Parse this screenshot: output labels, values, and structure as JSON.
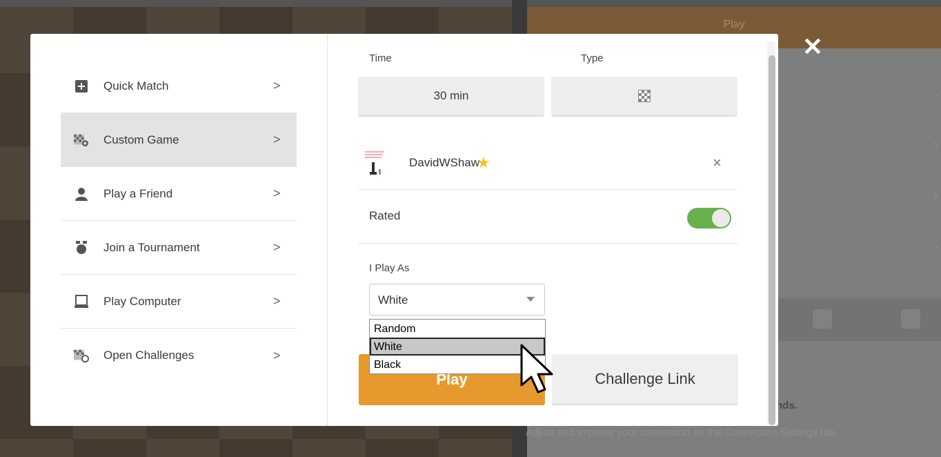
{
  "background": {
    "panel_header": "Play",
    "info_bold": "nds.",
    "info_text": "Adjust and improve your connection on the Connection Settings tab."
  },
  "menu": {
    "items": [
      {
        "label": "Quick Match",
        "icon": "plus-square-icon"
      },
      {
        "label": "Custom Game",
        "icon": "board-gear-icon"
      },
      {
        "label": "Play a Friend",
        "icon": "person-icon"
      },
      {
        "label": "Join a Tournament",
        "icon": "trophy-icon"
      },
      {
        "label": "Play Computer",
        "icon": "computer-icon"
      },
      {
        "label": "Open Challenges",
        "icon": "board-circle-icon"
      }
    ],
    "active_index": 1,
    "chevron": ">"
  },
  "settings": {
    "time_label": "Time",
    "time_value": "30 min",
    "type_label": "Type",
    "type_icon": "checkerboard-icon"
  },
  "opponent": {
    "name": "DavidWShaw",
    "badge": "★",
    "remove": "×"
  },
  "rated": {
    "label": "Rated",
    "enabled": true
  },
  "play_as": {
    "label": "I Play As",
    "selected": "White",
    "options": [
      "Random",
      "White",
      "Black"
    ],
    "highlighted": "White"
  },
  "actions": {
    "play": "Play",
    "challenge_link": "Challenge Link"
  },
  "close": "✕",
  "colors": {
    "play_orange": "#e69a2e",
    "toggle_green": "#6ab04c",
    "star_yellow": "#f4c221"
  }
}
